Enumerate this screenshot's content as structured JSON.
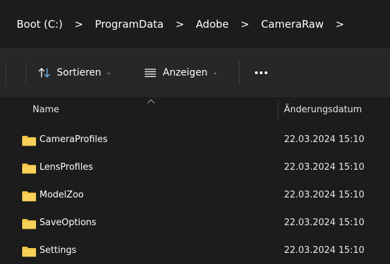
{
  "breadcrumb": {
    "items": [
      "Boot (C:)",
      "ProgramData",
      "Adobe",
      "CameraRaw"
    ],
    "separator": ">"
  },
  "toolbar": {
    "sort_label": "Sortieren",
    "view_label": "Anzeigen",
    "more_label": "···",
    "sort_icon": "sort-arrows-icon",
    "view_icon": "view-lines-icon"
  },
  "columns": {
    "name": "Name",
    "modified": "Änderungsdatum"
  },
  "files": [
    {
      "name": "CameraProfiles",
      "modified": "22.03.2024 15:10",
      "type": "folder"
    },
    {
      "name": "LensProfiles",
      "modified": "22.03.2024 15:10",
      "type": "folder"
    },
    {
      "name": "ModelZoo",
      "modified": "22.03.2024 15:10",
      "type": "folder"
    },
    {
      "name": "SaveOptions",
      "modified": "22.03.2024 15:10",
      "type": "folder"
    },
    {
      "name": "Settings",
      "modified": "22.03.2024 15:10",
      "type": "folder"
    }
  ],
  "colors": {
    "background": "#1c1c1c",
    "toolbar": "#272727",
    "folder": "#f4c542",
    "text": "#ffffff",
    "sort_icon_accent": "#6cb8f6"
  }
}
